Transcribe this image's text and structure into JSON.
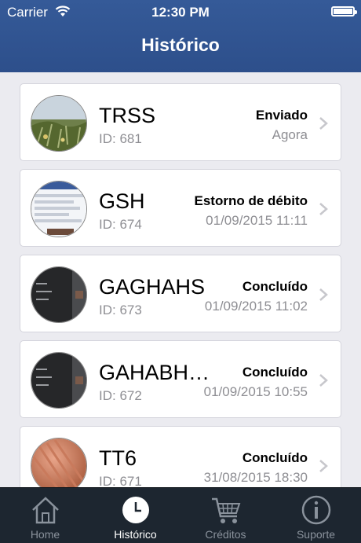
{
  "status_bar": {
    "carrier": "Carrier",
    "time": "12:30 PM"
  },
  "nav": {
    "title": "Histórico"
  },
  "items": [
    {
      "name": "TRSS",
      "id": "ID: 681",
      "status": "Enviado",
      "date": "Agora"
    },
    {
      "name": "GSH",
      "id": "ID: 674",
      "status": "Estorno de débito",
      "date": "01/09/2015 11:11"
    },
    {
      "name": "GAGHAHS",
      "id": "ID: 673",
      "status": "Concluído",
      "date": "01/09/2015 11:02"
    },
    {
      "name": "GAHABH…",
      "id": "ID: 672",
      "status": "Concluído",
      "date": "01/09/2015 10:55"
    },
    {
      "name": "TT6",
      "id": "ID: 671",
      "status": "Concluído",
      "date": "31/08/2015 18:30"
    }
  ],
  "tabs": [
    {
      "label": "Home",
      "icon": "home-icon"
    },
    {
      "label": "Histórico",
      "icon": "clock-icon",
      "active": true
    },
    {
      "label": "Créditos",
      "icon": "cart-icon"
    },
    {
      "label": "Suporte",
      "icon": "info-icon"
    }
  ],
  "colors": {
    "nav_bar": "#2f5290",
    "tab_bar": "#1d2630",
    "background": "#ebebf0"
  }
}
